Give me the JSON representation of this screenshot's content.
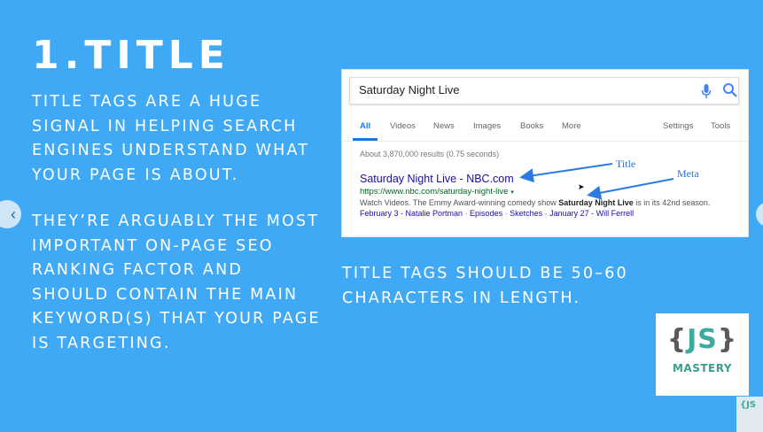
{
  "slide": {
    "heading": "1.TITLE",
    "paragraph1": "TITLE TAGS ARE A HUGE SIGNAL IN HELPING SEARCH ENGINES UNDERSTAND WHAT YOUR PAGE IS ABOUT.",
    "paragraph2": "THEY’RE ARGUABLY THE MOST IMPORTANT ON-PAGE SEO RANKING FACTOR AND SHOULD CONTAIN THE MAIN KEYWORD(S) THAT YOUR PAGE IS TARGETING.",
    "note": "TITLE TAGS SHOULD BE 50–60 CHARACTERS IN LENGTH.",
    "background_color": "#3fa9f5",
    "prev_icon": "chevron-left-icon"
  },
  "serp": {
    "query": "Saturday Night Live",
    "tabs": [
      "All",
      "Videos",
      "News",
      "Images",
      "Books",
      "More",
      "Settings",
      "Tools"
    ],
    "active_tab": "All",
    "result_stats": "About 3,870,000 results (0.75 seconds)",
    "result": {
      "title": "Saturday Night Live - NBC.com",
      "url": "https://www.nbc.com/saturday-night-live",
      "url_caret": "▾",
      "desc_pre": "Watch Videos. The Emmy Award-winning comedy show ",
      "desc_bold": "Saturday Night Live",
      "desc_post": " is in its 42nd season.",
      "sitelinks": [
        "February 3 - Natalie Portman",
        "Episodes",
        "Sketches",
        "January 27 - Will Ferrell"
      ]
    },
    "annotations": {
      "title_label": "Title",
      "meta_label": "Meta"
    },
    "icons": [
      "microphone-icon",
      "search-icon"
    ]
  },
  "logo": {
    "brace_open": "{",
    "letters": "JS",
    "brace_close": "}",
    "word": "MASTERY",
    "peek": "{JS"
  }
}
